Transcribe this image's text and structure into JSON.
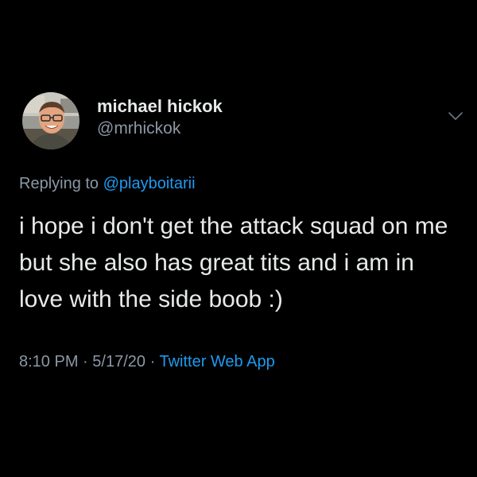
{
  "colors": {
    "background": "#000000",
    "text_primary": "#e7e9ea",
    "text_secondary": "#8b98a5",
    "accent": "#1d9bf0"
  },
  "author": {
    "display_name": "michael hickok",
    "handle": "@mrhickok",
    "avatar_icon": "avatar-photo"
  },
  "reply": {
    "prefix": "Replying to",
    "mention": "@playboitarii"
  },
  "tweet": {
    "text": "i hope i don't get the attack squad on me but she also has great tits and i am in love with the side boob :)"
  },
  "meta": {
    "time": "8:10 PM",
    "separator1": "·",
    "date": "5/17/20",
    "separator2": "·",
    "source": "Twitter Web App"
  },
  "icons": {
    "more_menu": "chevron-down-icon"
  }
}
